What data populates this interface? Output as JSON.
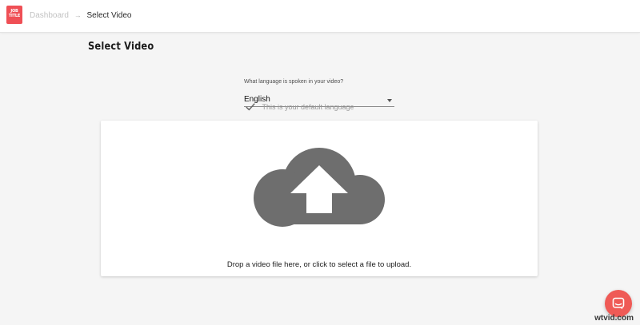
{
  "brand": {
    "logo_line1": "JOB",
    "logo_line2": "TITLE",
    "accent_color": "#ef4f55"
  },
  "breadcrumb": {
    "parent": "Dashboard",
    "separator": "→",
    "current": "Select Video"
  },
  "page": {
    "title": "Select Video"
  },
  "language": {
    "label": "What language is spoken in your video?",
    "selected": "English",
    "default_note": "This is your default language"
  },
  "dropzone": {
    "icon": "cloud-upload-icon",
    "text": "Drop a video file here, or click to select a file to upload."
  },
  "chat": {
    "icon": "chat-bubble-icon",
    "color": "#ef5a56"
  },
  "watermark": {
    "text": "wtvid.com"
  }
}
